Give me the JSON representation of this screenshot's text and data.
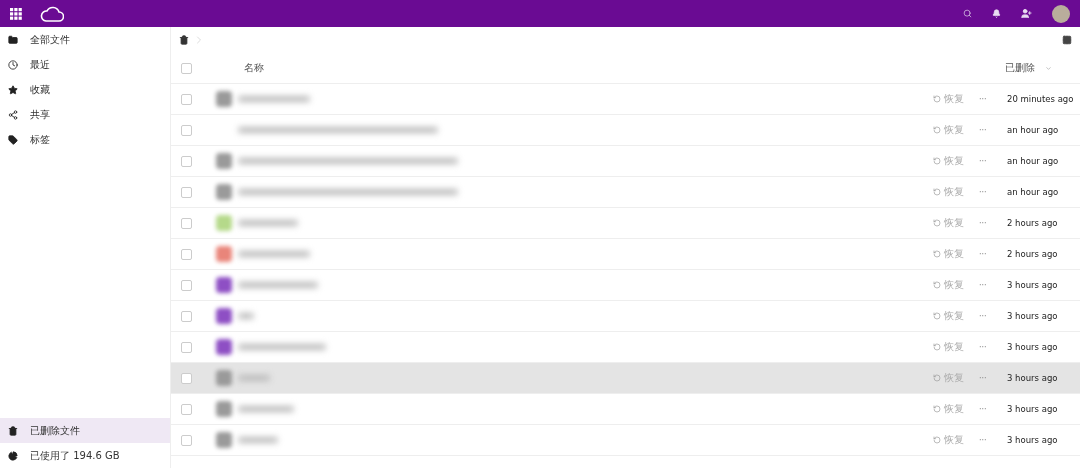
{
  "sidebar": {
    "items": [
      {
        "kind": "folder",
        "label": "全部文件",
        "selected": false
      },
      {
        "kind": "clock",
        "label": "最近",
        "selected": false
      },
      {
        "kind": "star",
        "label": "收藏",
        "selected": false
      },
      {
        "kind": "share",
        "label": "共享",
        "selected": false
      },
      {
        "kind": "tag",
        "label": "标签",
        "selected": false
      }
    ],
    "bottom": [
      {
        "kind": "trash",
        "label": "已删除文件",
        "selected": true
      },
      {
        "kind": "pie",
        "label": "已使用了 194.6 GB",
        "selected": false
      }
    ]
  },
  "table": {
    "columns": {
      "name": "名称",
      "deleted": "已删除"
    },
    "select_all": {
      "checked": false
    },
    "rows": [
      {
        "color": "#9a9a9a",
        "checked": false,
        "restore": "恢复",
        "more": "···",
        "deleted": "20 minutes ago",
        "highlighted": false
      },
      {
        "checked": false,
        "restore": "恢复",
        "more": "···",
        "deleted": "an hour ago",
        "highlighted": false
      },
      {
        "color": "#9a9a9a",
        "checked": false,
        "restore": "恢复",
        "more": "···",
        "deleted": "an hour ago",
        "highlighted": false
      },
      {
        "color": "#9a9a9a",
        "checked": false,
        "restore": "恢复",
        "more": "···",
        "deleted": "an hour ago",
        "highlighted": false
      },
      {
        "color": "#b5d98a",
        "checked": false,
        "restore": "恢复",
        "more": "···",
        "deleted": "2 hours ago",
        "highlighted": false
      },
      {
        "color": "#e9857a",
        "checked": false,
        "restore": "恢复",
        "more": "···",
        "deleted": "2 hours ago",
        "highlighted": false
      },
      {
        "color": "#8e4fc4",
        "checked": false,
        "restore": "恢复",
        "more": "···",
        "deleted": "3 hours ago",
        "highlighted": false
      },
      {
        "color": "#8e4fc4",
        "checked": false,
        "restore": "恢复",
        "more": "···",
        "deleted": "3 hours ago",
        "highlighted": false
      },
      {
        "color": "#8e4fc4",
        "checked": false,
        "restore": "恢复",
        "more": "···",
        "deleted": "3 hours ago",
        "highlighted": false
      },
      {
        "color": "#9a9a9a",
        "checked": false,
        "restore": "恢复",
        "more": "···",
        "deleted": "3 hours ago",
        "highlighted": true
      },
      {
        "color": "#9a9a9a",
        "checked": false,
        "restore": "恢复",
        "more": "···",
        "deleted": "3 hours ago",
        "highlighted": false
      },
      {
        "color": "#9a9a9a",
        "checked": false,
        "restore": "恢复",
        "more": "···",
        "deleted": "3 hours ago",
        "highlighted": false
      }
    ]
  }
}
